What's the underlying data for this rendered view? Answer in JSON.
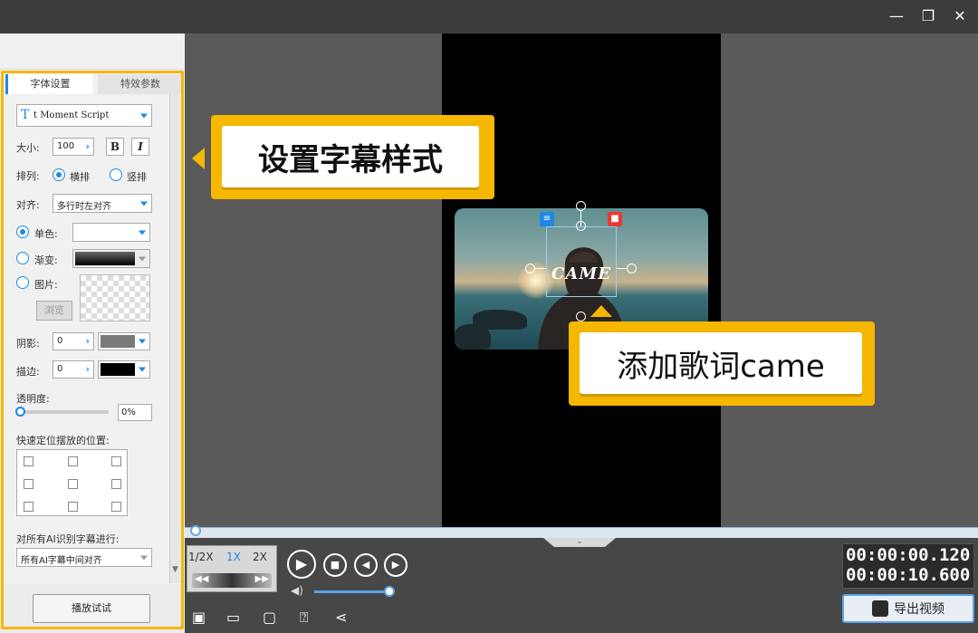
{
  "window": {
    "minimize_glyph": "—",
    "restore_glyph": "❐",
    "close_glyph": "✕"
  },
  "tabs": [
    {
      "label": "字体设置",
      "active": true
    },
    {
      "label": "特效参数",
      "active": false
    }
  ],
  "font": {
    "icon_glyph": "T",
    "name": "t Moment Script",
    "size_label": "大小:",
    "size_value": "100",
    "bold_label": "B",
    "italic_label": "I"
  },
  "layout": {
    "label": "排列:",
    "horizontal": "横排",
    "vertical": "竖排"
  },
  "align": {
    "label": "对齐:",
    "value": "多行时左对齐"
  },
  "color": {
    "single_label": "单色:",
    "gradient_label": "渐变:",
    "image_label": "图片:",
    "browse_label": "浏览"
  },
  "shadow": {
    "label": "阴影:",
    "value": "0"
  },
  "stroke": {
    "label": "描边:",
    "value": "0"
  },
  "opacity": {
    "label": "透明度:",
    "value": "0%"
  },
  "quick_pos": {
    "label": "快速定位摆放的位置:"
  },
  "ai": {
    "label": "对所有AI识别字幕进行:",
    "value": "所有AI字幕中间对齐"
  },
  "left_bottom": {
    "play_try": "播放试试"
  },
  "preview": {
    "caption": "CAME"
  },
  "callouts": {
    "style": "设置字幕样式",
    "lyric": "添加歌词came"
  },
  "playback": {
    "speed_half": "1/2X",
    "speed_1x": "1X",
    "speed_2x": "2X",
    "rewind": "◀◀",
    "forward": "▶▶",
    "current_time": "00:00:00.120",
    "total_time": "00:00:10.600",
    "export_label": "导出视频"
  },
  "colors": {
    "accent": "#f5b700",
    "blue": "#1f88e5"
  }
}
